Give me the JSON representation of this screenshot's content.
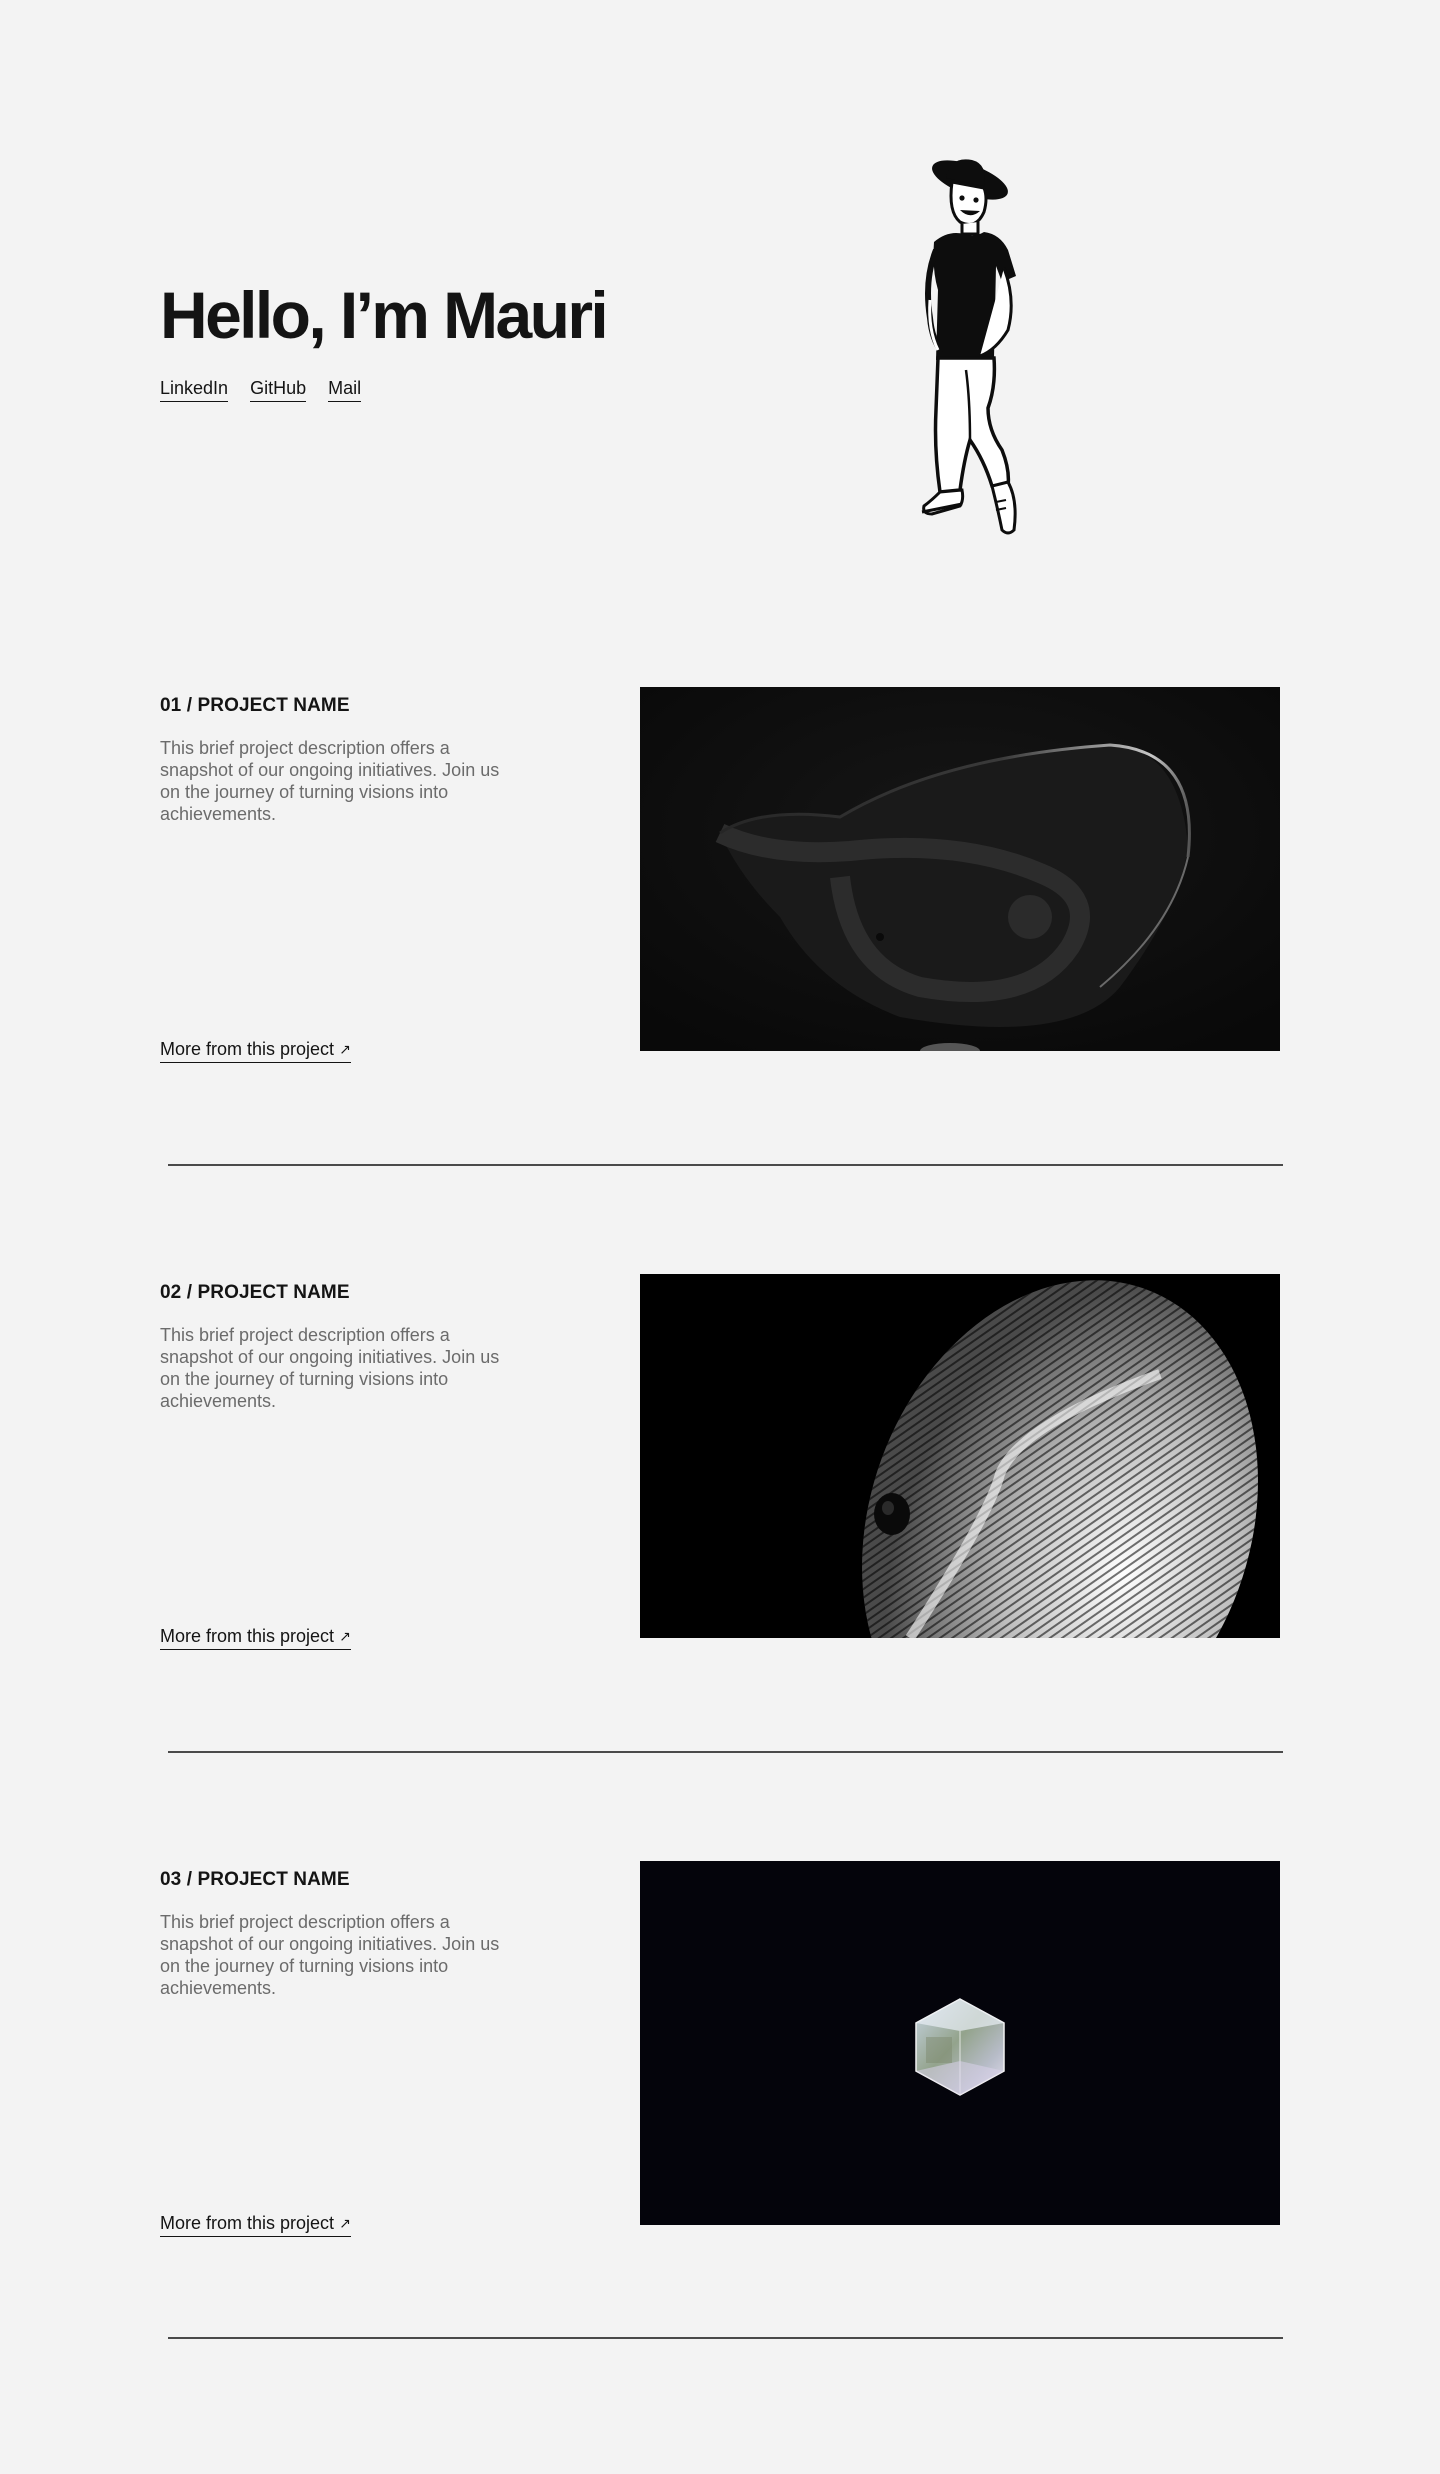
{
  "hero": {
    "title": "Hello, I’m Mauri",
    "links": [
      {
        "label": "LinkedIn"
      },
      {
        "label": "GitHub"
      },
      {
        "label": "Mail"
      }
    ],
    "avatar_icon": "walking-person-illustration"
  },
  "projects": [
    {
      "title": "01 / PROJECT NAME",
      "description": "This brief project description offers a snapshot of our ongoing initiatives. Join us on the journey of turning visions into achievements.",
      "more_label": "More from this project",
      "arrow_icon": "arrow-up-right-icon",
      "image_icon": "twisted-ribbon-render"
    },
    {
      "title": "02 / PROJECT NAME",
      "description": "This brief project description offers a snapshot of our ongoing initiatives. Join us on the journey of turning visions into achievements.",
      "more_label": "More from this project",
      "arrow_icon": "arrow-up-right-icon",
      "image_icon": "line-sphere-render"
    },
    {
      "title": "03 / PROJECT NAME",
      "description": "This brief project description offers a snapshot of our ongoing initiatives. Join us on the journey of turning visions into achievements.",
      "more_label": "More from this project",
      "arrow_icon": "arrow-up-right-icon",
      "image_icon": "glass-hexagon-render"
    }
  ],
  "colors": {
    "background": "#f3f3f3",
    "text": "#141414",
    "muted_text": "#6b6b6b",
    "divider": "#4a4a4a"
  }
}
